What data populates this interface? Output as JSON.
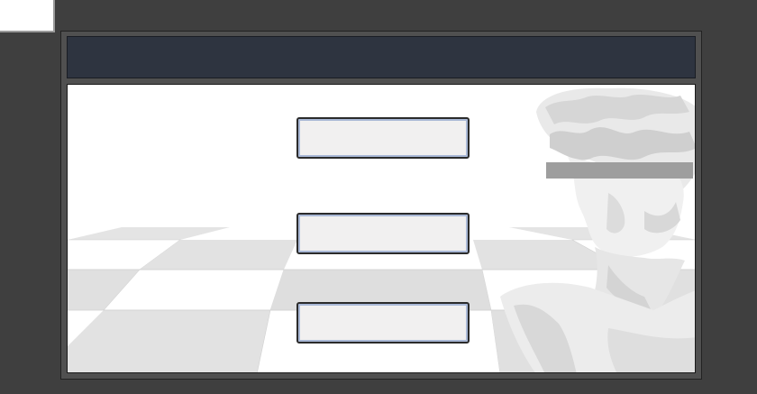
{
  "window": {
    "title": ""
  },
  "menu": {
    "buttons": [
      {
        "label": ""
      },
      {
        "label": ""
      },
      {
        "label": ""
      }
    ]
  },
  "colors": {
    "background": "#3f3f3f",
    "title_bar": "#2e3440",
    "button_fill": "#f1f0f0",
    "button_border": "#2b2b2b",
    "button_inner_ring": "#a9b8d6",
    "censor_bar": "#9e9e9e"
  },
  "icons": {
    "statue": "marble-bust-icon"
  }
}
